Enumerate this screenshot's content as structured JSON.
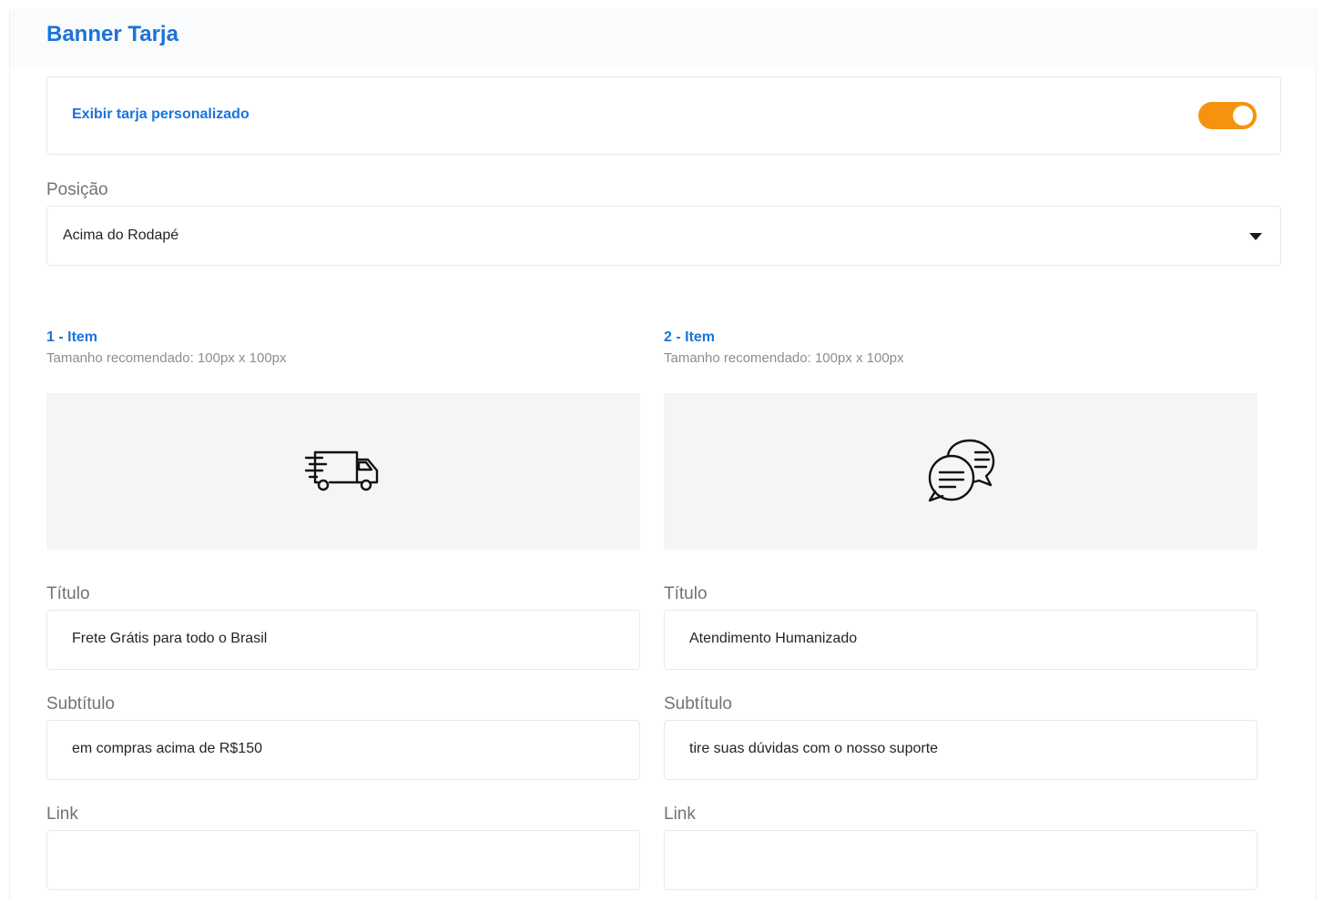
{
  "section": {
    "title": "Banner Tarja"
  },
  "toggle": {
    "label": "Exibir tarja personalizado",
    "enabled": true,
    "color": "#f59210"
  },
  "position": {
    "label": "Posição",
    "value": "Acima do Rodapé"
  },
  "items": [
    {
      "heading": "1 - Item",
      "hint": "Tamanho recomendado: 100px x 100px",
      "icon": "delivery-truck-icon",
      "title_label": "Título",
      "title_value": "Frete Grátis para todo o Brasil",
      "subtitle_label": "Subtítulo",
      "subtitle_value": "em compras acima de R$150",
      "link_label": "Link",
      "link_value": ""
    },
    {
      "heading": "2 - Item",
      "hint": "Tamanho recomendado: 100px x 100px",
      "icon": "chat-bubbles-icon",
      "title_label": "Título",
      "title_value": "Atendimento Humanizado",
      "subtitle_label": "Subtítulo",
      "subtitle_value": "tire suas dúvidas com o nosso suporte",
      "link_label": "Link",
      "link_value": ""
    }
  ],
  "colors": {
    "accent": "#1a73d9",
    "toggle_on": "#f59210",
    "image_placeholder": "#f3f5f7"
  }
}
